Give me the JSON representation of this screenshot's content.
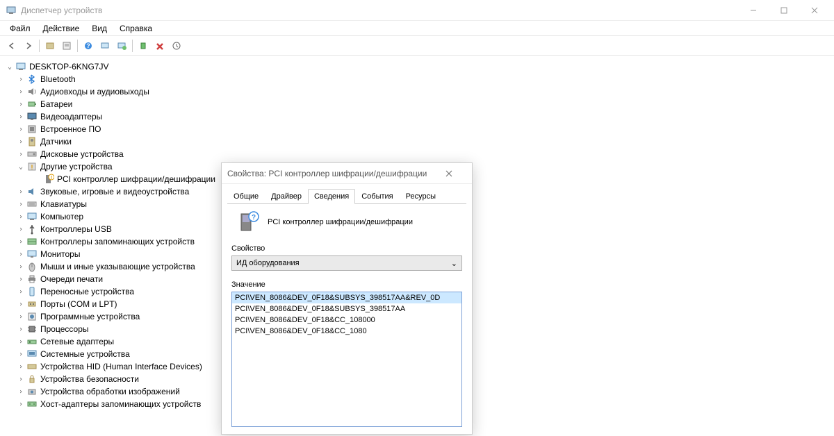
{
  "window": {
    "title": "Диспетчер устройств"
  },
  "menu": {
    "file": "Файл",
    "action": "Действие",
    "view": "Вид",
    "help": "Справка"
  },
  "tree": {
    "root": "DESKTOP-6KNG7JV",
    "items": [
      {
        "label": "Bluetooth",
        "icon": "bluetooth"
      },
      {
        "label": "Аудиовходы и аудиовыходы",
        "icon": "audio"
      },
      {
        "label": "Батареи",
        "icon": "battery"
      },
      {
        "label": "Видеоадаптеры",
        "icon": "display"
      },
      {
        "label": "Встроенное ПО",
        "icon": "firmware"
      },
      {
        "label": "Датчики",
        "icon": "sensor"
      },
      {
        "label": "Дисковые устройства",
        "icon": "disk"
      },
      {
        "label": "Другие устройства",
        "icon": "other",
        "expanded": true,
        "children": [
          {
            "label": "PCI контроллер шифрации/дешифрации",
            "icon": "unknown"
          }
        ]
      },
      {
        "label": "Звуковые, игровые и видеоустройства",
        "icon": "sound"
      },
      {
        "label": "Клавиатуры",
        "icon": "keyboard"
      },
      {
        "label": "Компьютер",
        "icon": "computer"
      },
      {
        "label": "Контроллеры USB",
        "icon": "usb"
      },
      {
        "label": "Контроллеры запоминающих устройств",
        "icon": "storage"
      },
      {
        "label": "Мониторы",
        "icon": "monitor"
      },
      {
        "label": "Мыши и иные указывающие устройства",
        "icon": "mouse"
      },
      {
        "label": "Очереди печати",
        "icon": "printer"
      },
      {
        "label": "Переносные устройства",
        "icon": "portable"
      },
      {
        "label": "Порты (COM и LPT)",
        "icon": "port"
      },
      {
        "label": "Программные устройства",
        "icon": "software"
      },
      {
        "label": "Процессоры",
        "icon": "cpu"
      },
      {
        "label": "Сетевые адаптеры",
        "icon": "network"
      },
      {
        "label": "Системные устройства",
        "icon": "system"
      },
      {
        "label": "Устройства HID (Human Interface Devices)",
        "icon": "hid"
      },
      {
        "label": "Устройства безопасности",
        "icon": "security"
      },
      {
        "label": "Устройства обработки изображений",
        "icon": "imaging"
      },
      {
        "label": "Хост-адаптеры запоминающих устройств",
        "icon": "hostadapter"
      }
    ]
  },
  "dialog": {
    "title": "Свойства: PCI контроллер шифрации/дешифрации",
    "tabs": {
      "general": "Общие",
      "driver": "Драйвер",
      "details": "Сведения",
      "events": "События",
      "resources": "Ресурсы"
    },
    "device_name": "PCI контроллер шифрации/дешифрации",
    "property_label": "Свойство",
    "property_selected": "ИД оборудования",
    "value_label": "Значение",
    "values": [
      "PCI\\VEN_8086&DEV_0F18&SUBSYS_398517AA&REV_0D",
      "PCI\\VEN_8086&DEV_0F18&SUBSYS_398517AA",
      "PCI\\VEN_8086&DEV_0F18&CC_108000",
      "PCI\\VEN_8086&DEV_0F18&CC_1080"
    ]
  }
}
